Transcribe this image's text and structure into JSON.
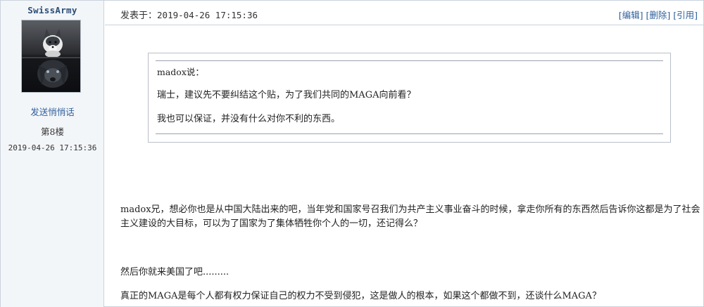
{
  "user": {
    "name": "SwissArmy",
    "send_message": "发送悄悄话",
    "floor": "第8楼",
    "date": "2019-04-26 17:15:36"
  },
  "header": {
    "posted_label": "发表于：",
    "posted_time": "2019-04-26 17:15:36",
    "actions": [
      "[编辑]",
      "[删除]",
      "[引用]"
    ]
  },
  "quote": {
    "author": "madox说：",
    "lines": [
      "瑞士，建议先不要纠结这个贴，为了我们共同的MAGA向前看？",
      "我也可以保证，并没有什么对你不利的东西。"
    ]
  },
  "body": {
    "paragraphs": [
      "madox兄，想必你也是从中国大陆出来的吧，当年党和国家号召我们为共产主义事业奋斗的时候，拿走你所有的东西然后告诉你这都是为了社会主义建设的大目标，可以为了国家为了集体牺牲你个人的一切，还记得么？",
      "然后你就来美国了吧.........",
      "真正的MAGA是每个人都有权力保证自己的权力不受到侵犯，这是做人的根本，如果这个都做不到，还谈什么MAGA？"
    ]
  },
  "colors": {
    "link": "#2f5f9c",
    "username": "#2b4e77",
    "sidebar_bg": "#f3f6f9",
    "border": "#c9d2dc"
  }
}
